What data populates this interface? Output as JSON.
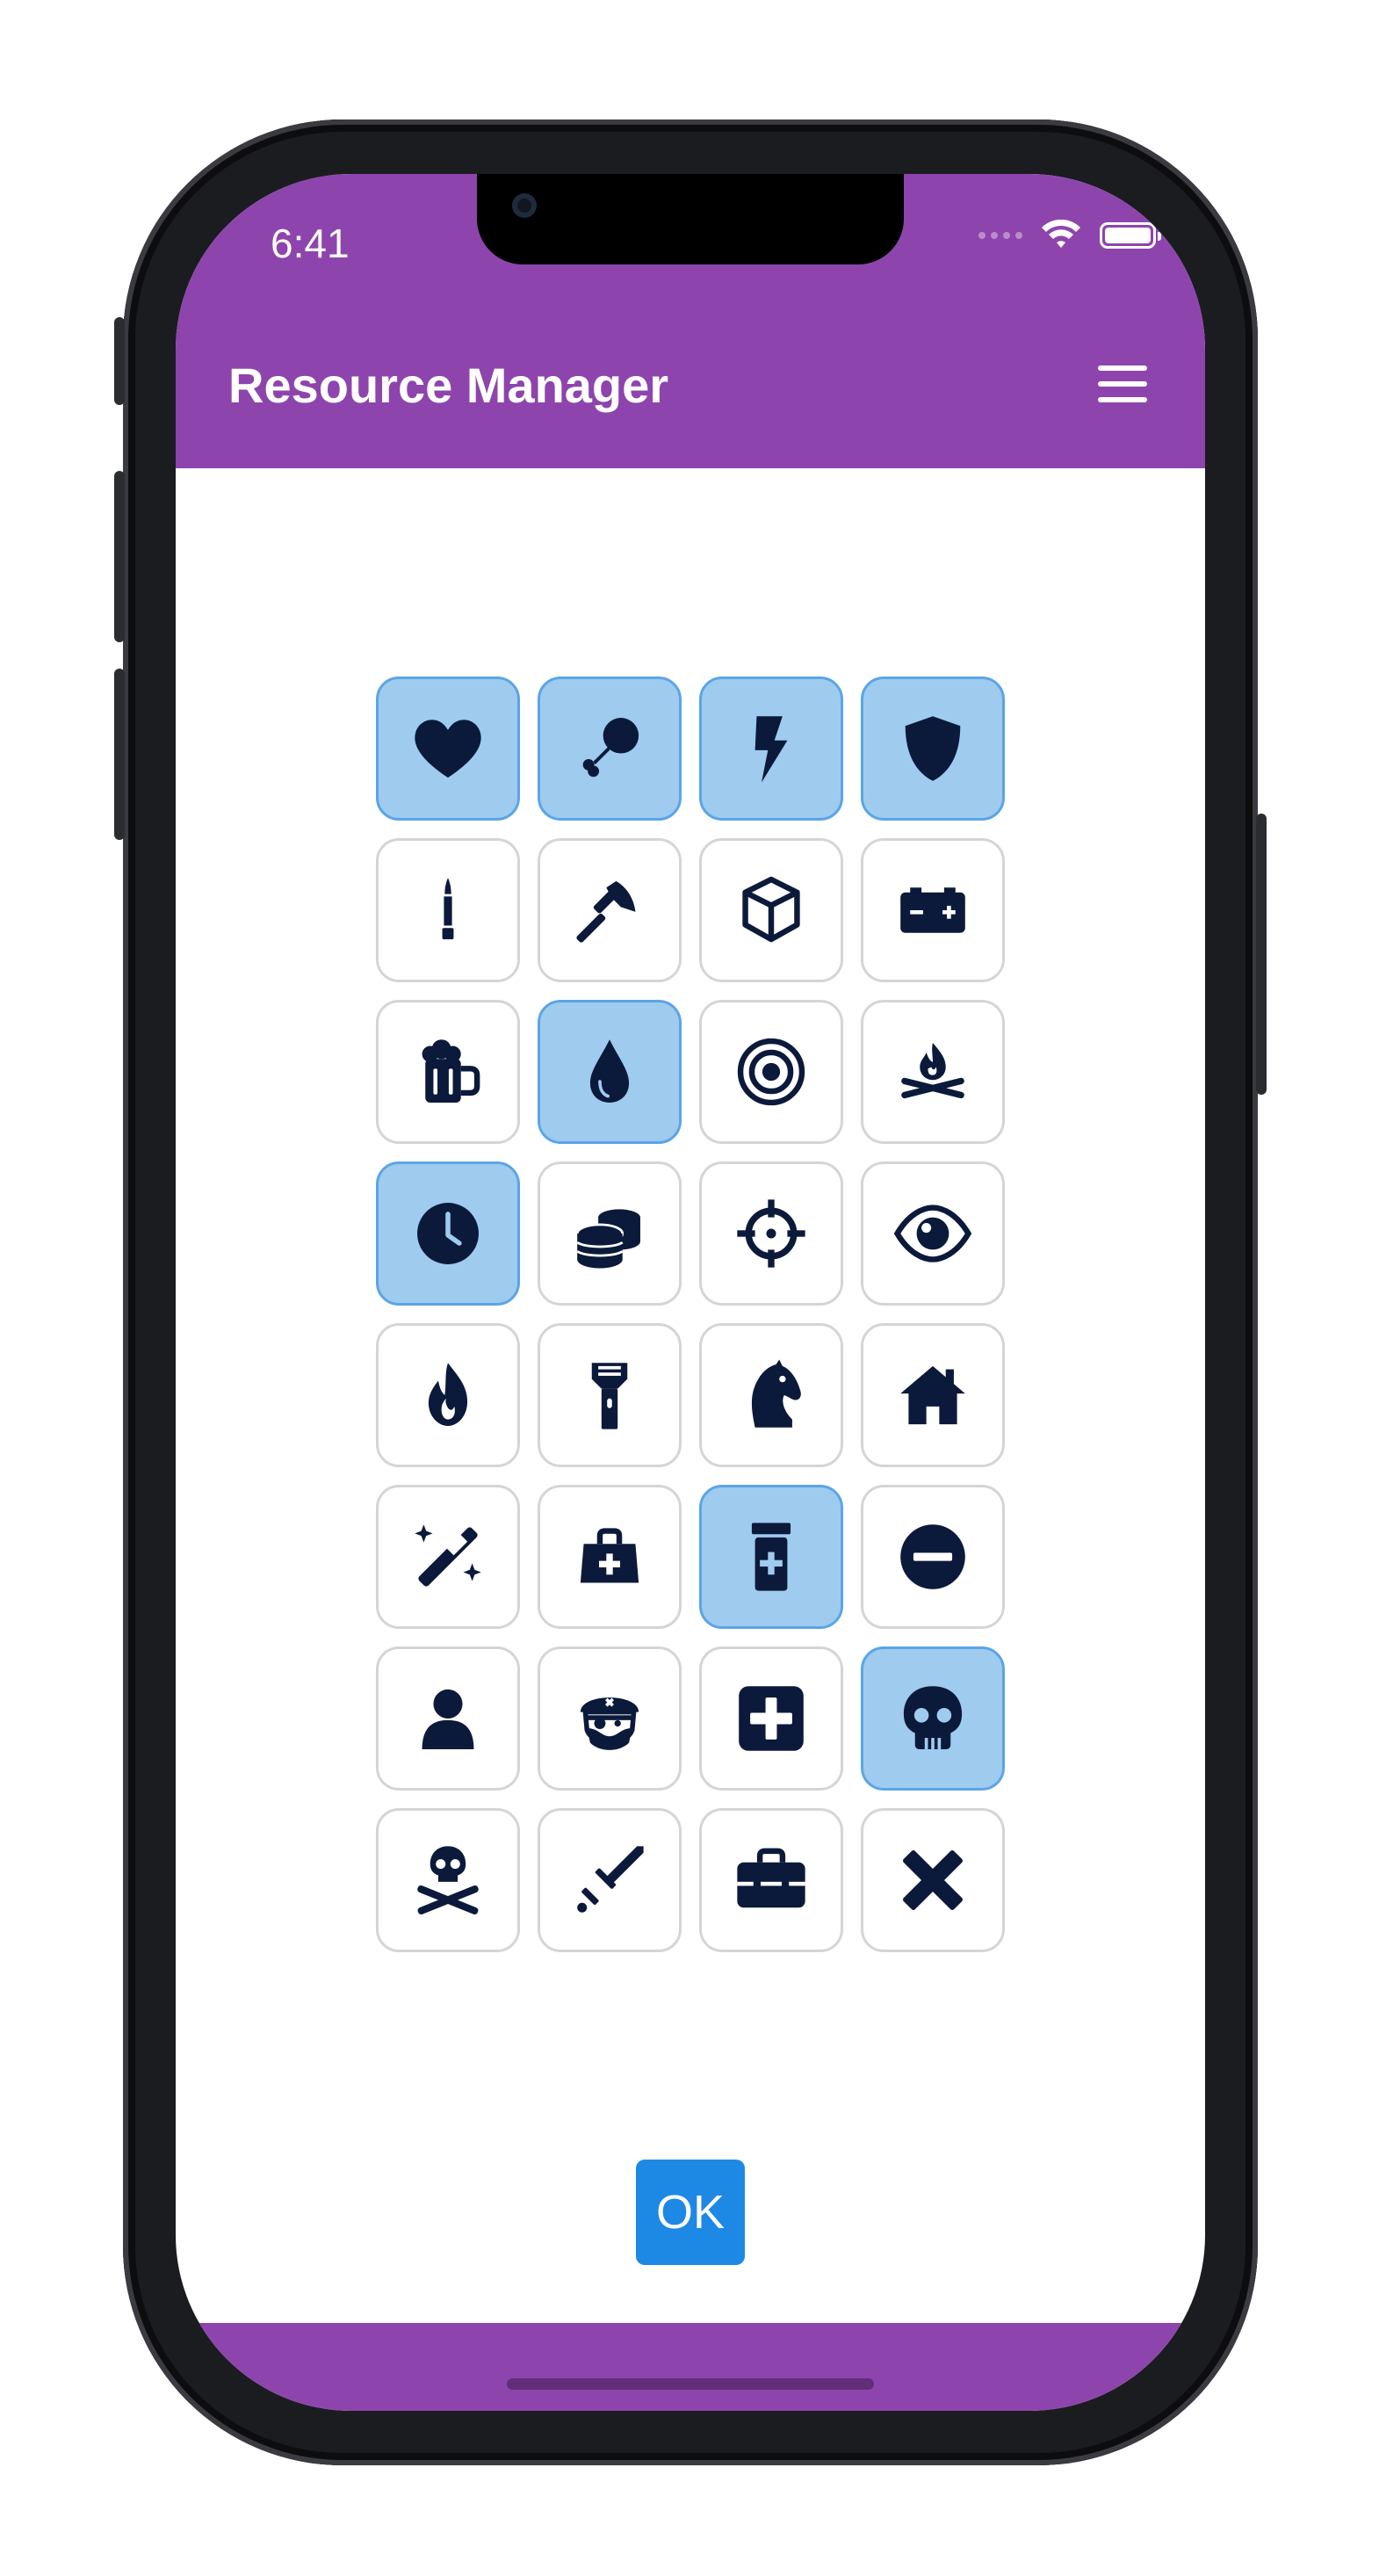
{
  "status_bar": {
    "time": "6:41"
  },
  "app_bar": {
    "title": "Resource Manager",
    "menu_icon": "hamburger-menu-icon"
  },
  "colors": {
    "app_bar": "#8e44ad",
    "tile_selected": "#9fcbef",
    "tile_selected_border": "#5aa5e6",
    "icon": "#0b1a3a",
    "ok_button": "#1e88e5"
  },
  "resources": [
    {
      "icon": "heart-icon",
      "selected": true
    },
    {
      "icon": "drumstick-icon",
      "selected": true
    },
    {
      "icon": "lightning-bolt-icon",
      "selected": true
    },
    {
      "icon": "shield-icon",
      "selected": true
    },
    {
      "icon": "bullet-icon",
      "selected": false
    },
    {
      "icon": "axe-icon",
      "selected": false
    },
    {
      "icon": "cube-icon",
      "selected": false
    },
    {
      "icon": "battery-icon",
      "selected": false
    },
    {
      "icon": "beer-mug-icon",
      "selected": false
    },
    {
      "icon": "water-drop-icon",
      "selected": true
    },
    {
      "icon": "bullseye-icon",
      "selected": false
    },
    {
      "icon": "campfire-icon",
      "selected": false
    },
    {
      "icon": "clock-icon",
      "selected": true
    },
    {
      "icon": "coins-icon",
      "selected": false
    },
    {
      "icon": "crosshairs-icon",
      "selected": false
    },
    {
      "icon": "eye-icon",
      "selected": false
    },
    {
      "icon": "fire-icon",
      "selected": false
    },
    {
      "icon": "flashlight-icon",
      "selected": false
    },
    {
      "icon": "horse-head-icon",
      "selected": false
    },
    {
      "icon": "house-icon",
      "selected": false
    },
    {
      "icon": "magic-wand-icon",
      "selected": false
    },
    {
      "icon": "medical-bag-icon",
      "selected": false
    },
    {
      "icon": "prescription-bottle-icon",
      "selected": true
    },
    {
      "icon": "minus-circle-icon",
      "selected": false
    },
    {
      "icon": "person-icon",
      "selected": false
    },
    {
      "icon": "pirate-icon",
      "selected": false
    },
    {
      "icon": "plus-square-icon",
      "selected": false
    },
    {
      "icon": "skull-icon",
      "selected": true
    },
    {
      "icon": "skull-crossbones-icon",
      "selected": false
    },
    {
      "icon": "sword-icon",
      "selected": false
    },
    {
      "icon": "toolbox-icon",
      "selected": false
    },
    {
      "icon": "x-mark-icon",
      "selected": false
    }
  ],
  "ok_button": {
    "label": "OK"
  }
}
